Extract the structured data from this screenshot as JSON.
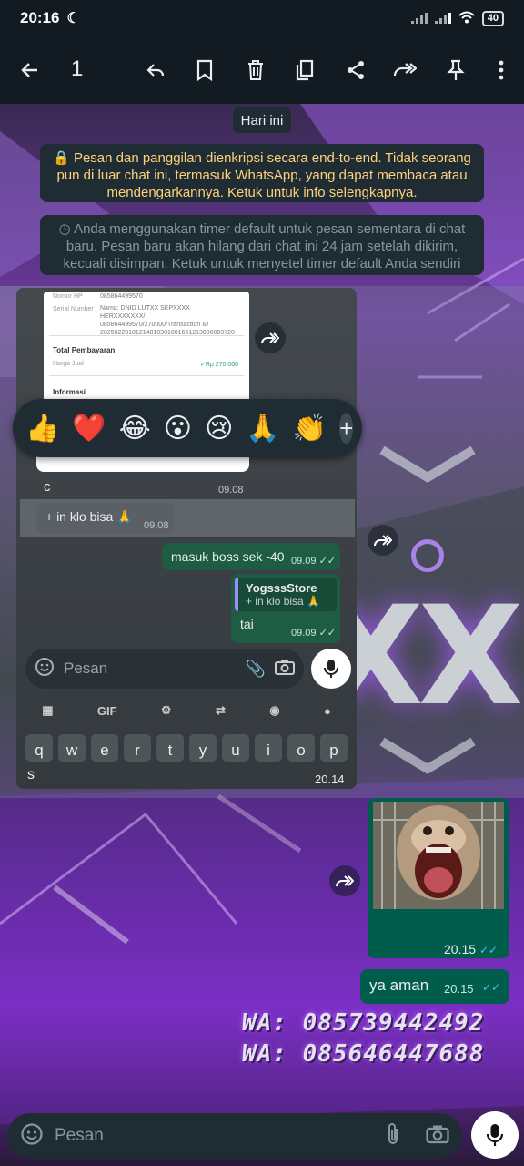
{
  "status_bar": {
    "time": "20:16",
    "battery": "40"
  },
  "toolbar": {
    "selected_count": "1"
  },
  "chat": {
    "date_chip": "Hari ini",
    "encryption_notice": "🔒 Pesan dan panggilan dienkripsi secara end-to-end. Tidak seorang pun di luar chat ini, termasuk WhatsApp, yang dapat membaca atau mendengarkannya. Ketuk untuk info selengkapnya.",
    "timer_notice": "◷ Anda menggunakan timer default untuk pesan sementara di chat baru. Pesan baru akan hilang dari chat ini 24 jam setelah dikirim, kecuali disimpan. Ketuk untuk menyetel timer default Anda sendiri",
    "image_message": {
      "time": "20.14",
      "inner": {
        "card_labels": {
          "nomor_hp": "Nomor HP",
          "nomor_hp_value": "085864499570",
          "serial": "Serial Number",
          "serial_value": "Nama: DNID LUTXX SEPXXXX HERXXXXXXX/ 085864499570/270000/Transaction ID 20250220101214810301001661213000089720",
          "total": "Total Pembayaran",
          "harga": "Harga Jual",
          "harga_value": "✓Rp 270.000",
          "informasi": "Informasi"
        },
        "msg_c": "c",
        "msg_c_time": "09.08",
        "msg_klo": "+ in klo bisa 🙏",
        "msg_klo_time": "09.08",
        "msg_boss": "masuk boss sek -40",
        "msg_boss_time": "09.09 ✓✓",
        "reply_name": "YogsssStore",
        "reply_text": "+ in klo bisa 🙏",
        "msg_tai": "tai",
        "msg_tai_time": "09.09 ✓✓",
        "input_placeholder": "Pesan",
        "kb_gif": "GIF",
        "keys": [
          "q",
          "w",
          "e",
          "r",
          "t",
          "y",
          "u",
          "i",
          "o",
          "p"
        ],
        "typed": "s"
      }
    },
    "reactions": [
      "👍",
      "❤️",
      "😂",
      "😮",
      "😢",
      "🙏",
      "👏"
    ],
    "monkey_time": "20.15",
    "ya_aman": "ya aman",
    "ya_aman_time": "20.15",
    "wallpaper_lines": [
      "WA:  085739442492",
      "WA:  085646447688"
    ]
  },
  "input": {
    "placeholder": "Pesan"
  },
  "colors": {
    "header": "#121b22",
    "bubble_out": "#005c4b",
    "read_tick": "#53bdeb"
  }
}
